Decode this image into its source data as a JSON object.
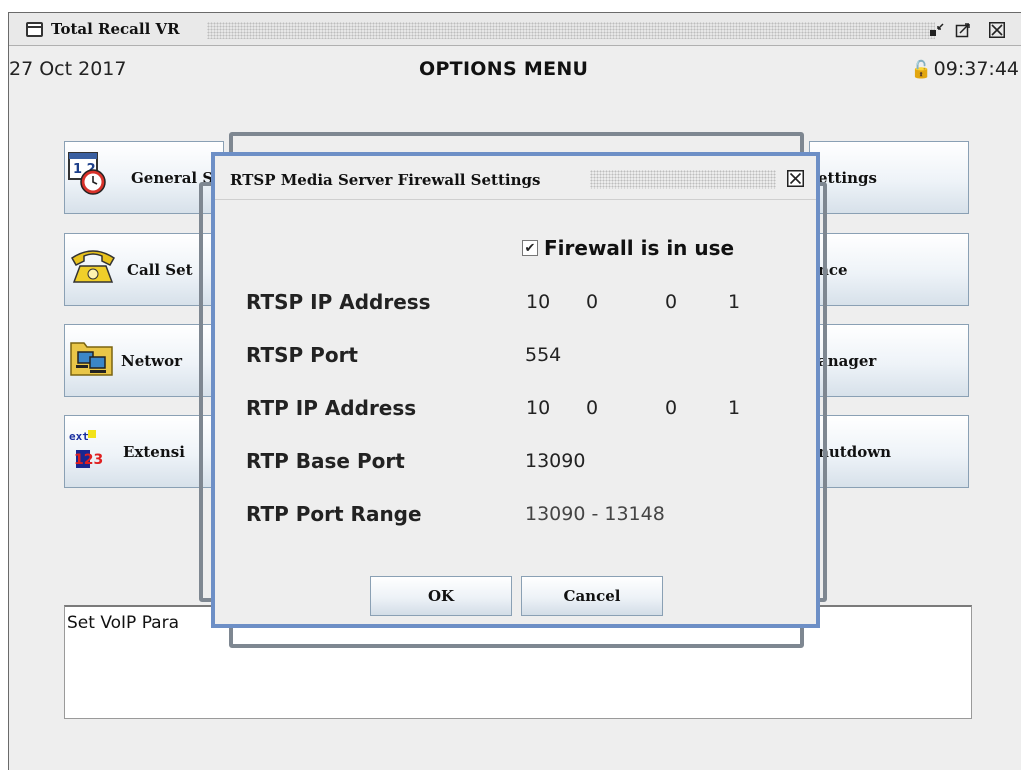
{
  "window": {
    "title": "Total Recall VR",
    "controls": [
      "minimize-icon",
      "maximize-icon",
      "close-icon"
    ]
  },
  "header": {
    "date": "27 Oct 2017",
    "title": "OPTIONS MENU",
    "time": "09:37:44"
  },
  "options": {
    "left": [
      {
        "label": "General S",
        "icon": "calendar-clock-icon"
      },
      {
        "label": "Call Set",
        "icon": "telephone-icon"
      },
      {
        "label": "Networ",
        "icon": "network-computers-icon"
      },
      {
        "label": "Extensi",
        "icon": "extension-123-icon"
      }
    ],
    "right": [
      {
        "label": "ettings"
      },
      {
        "label": "nce"
      },
      {
        "label": "anager"
      },
      {
        "label": "nutdown"
      }
    ]
  },
  "status": {
    "text": "Set VoIP Para"
  },
  "dialog": {
    "title": "RTSP Media Server Firewall Settings",
    "firewall_checkbox": {
      "label": "Firewall is in use",
      "checked": true
    },
    "fields": {
      "rtsp_ip": {
        "label": "RTSP IP Address",
        "octets": [
          "10",
          "0",
          "0",
          "1"
        ]
      },
      "rtsp_port": {
        "label": "RTSP Port",
        "value": "554"
      },
      "rtp_ip": {
        "label": "RTP IP Address",
        "octets": [
          "10",
          "0",
          "0",
          "1"
        ]
      },
      "rtp_base_port": {
        "label": "RTP Base Port",
        "value": "13090"
      },
      "rtp_port_range": {
        "label": "RTP Port Range",
        "value": "13090 - 13148"
      }
    },
    "ok_label": "OK",
    "cancel_label": "Cancel"
  },
  "colors": {
    "dialog_border": "#6d8fc6",
    "button_border": "#8aa0b4",
    "frame_border": "#7e8791"
  }
}
